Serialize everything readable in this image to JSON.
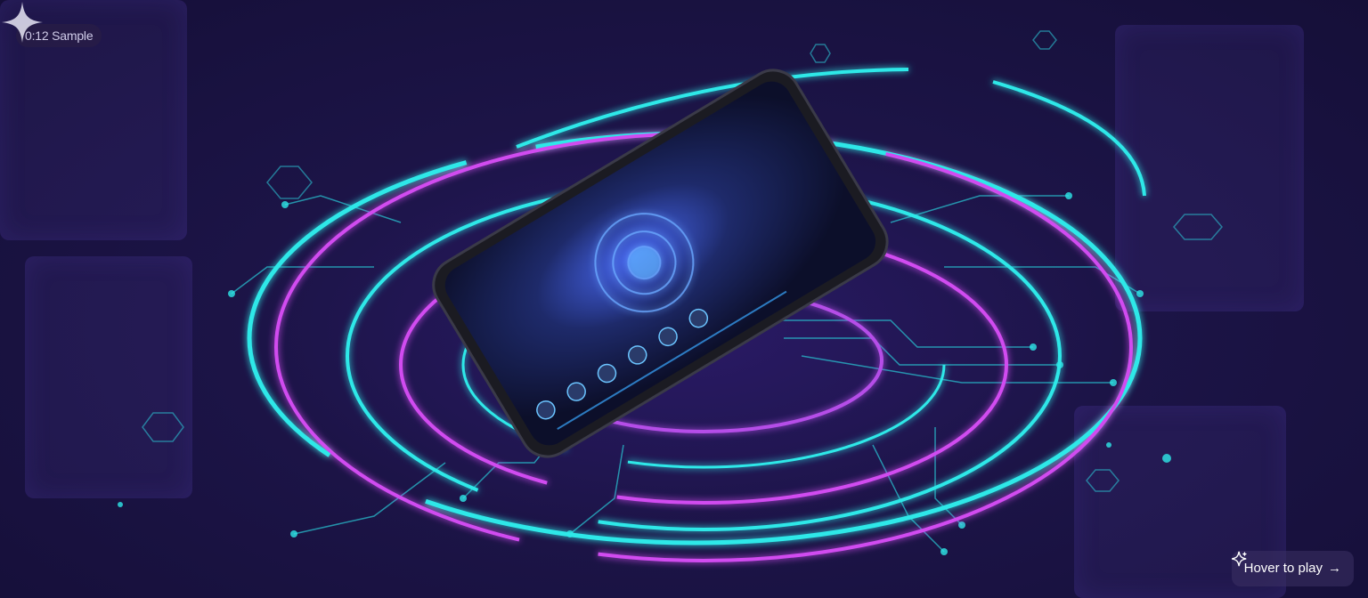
{
  "badge": {
    "label": "0:12 Sample"
  },
  "play_button": {
    "label": "Hover to play",
    "arrow": "→",
    "icon": "sparkle-icon"
  },
  "colors": {
    "background": "#1b1240",
    "cyan": "#2ee8e8",
    "magenta": "#d14cf0",
    "accent_blue": "#3aa8ff"
  }
}
